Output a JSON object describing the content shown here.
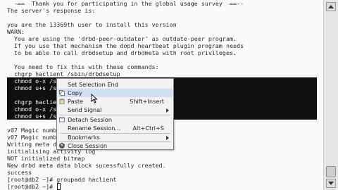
{
  "terminal": {
    "lines": [
      "  -==  Thank you for participating in the global usage survey  ==--",
      "The server's response is:",
      "",
      "you are the 13369th user to install this version",
      "WARN:",
      "  You are using the 'drbd-peer-outdater' as outdate-peer program.",
      "  If you use that mechanism the dopd heartbeat plugin program needs",
      "  to be able to call drbdsetup and drbdmeta with root privileges.",
      "",
      "  You need to fix this with these commands:",
      "  chgrp haclient /sbin/drbdsetup",
      "  chmod o-x /sbin/drbdsetup",
      "  chmod u+s /sbin/drbdsetup",
      "",
      "  chgrp haclient /sbin/drbdmeta",
      "  chmod o-x /sbin/drbdmeta",
      "  chmod u+s /sbin/drbdmeta",
      "",
      "v07 Magic number not found",
      "v07 Magic number not found",
      "Writing meta data...",
      "initialising activity log",
      "NOT initialized bitmap",
      "New drbd meta data block sucessfully created.",
      "success",
      "[root@db2 ~]# groupadd haclient",
      "[root@db2 ~]# "
    ]
  },
  "context_menu": {
    "items": [
      {
        "label": "Set Selection End",
        "shortcut": "",
        "submenu": false,
        "icon": ""
      },
      {
        "label": "Copy",
        "shortcut": "",
        "submenu": false,
        "icon": "copy-icon",
        "highlighted": true
      },
      {
        "label": "Paste",
        "shortcut": "Shift+Insert",
        "submenu": false,
        "icon": "paste-icon"
      },
      {
        "label": "Send Signal",
        "shortcut": "",
        "submenu": true,
        "icon": ""
      },
      {
        "label": "Detach Session",
        "shortcut": "",
        "submenu": false,
        "icon": "detach-icon"
      },
      {
        "label": "Rename Session...",
        "shortcut": "Alt+Ctrl+S",
        "submenu": false,
        "icon": ""
      },
      {
        "label": "Bookmarks",
        "shortcut": "",
        "submenu": true,
        "icon": ""
      },
      {
        "label": "Close Session",
        "shortcut": "",
        "submenu": false,
        "icon": "close-icon"
      }
    ]
  },
  "colors": {
    "background": "#fafafa",
    "selection": "#101010",
    "menu_highlight": "#cfe0f4"
  }
}
